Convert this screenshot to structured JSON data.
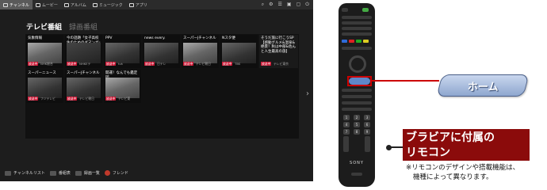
{
  "tv": {
    "topbar": {
      "tabs": [
        {
          "label": "チャンネル",
          "active": true
        },
        {
          "label": "ムービー",
          "active": false
        },
        {
          "label": "アルバム",
          "active": false
        },
        {
          "label": "ミュージック",
          "active": false
        },
        {
          "label": "アプリ",
          "active": false
        }
      ]
    },
    "section_title": "テレビ番組",
    "section_title_secondary": "録画番組",
    "tiles_row1": [
      {
        "title": "気象情報",
        "badge": "放送中",
        "channel": "NHK総合"
      },
      {
        "title": "今の話題「女子高校生のためのダマンガ」",
        "badge": "放送中",
        "channel": "NHKEテ"
      },
      {
        "title": "PPV",
        "badge": "放送中",
        "channel": "tvk"
      },
      {
        "title": "news every.",
        "badge": "放送中",
        "channel": "日テレ"
      },
      {
        "title": "スーパーJチャンネル",
        "badge": "放送中",
        "channel": "テレビ朝日"
      },
      {
        "title": "Nスタ便",
        "badge": "放送中",
        "channel": "TBS"
      },
      {
        "title": "そうだ旅に行こうSP【感動グルメ&温泉&絶景！秋は中部&佐んと人生最高の旅】",
        "badge": "放送中",
        "channel": "テレビ東京"
      }
    ],
    "tiles_row2": [
      {
        "title": "スーパーニュース",
        "badge": "放送中",
        "channel": "フジテレビ"
      },
      {
        "title": "スーパーJチャンネル",
        "badge": "放送中",
        "channel": "テレビ朝日"
      },
      {
        "title": "開運！なんでも鑑定団",
        "badge": "放送中",
        "channel": "テレビ東"
      }
    ],
    "bottombar": {
      "items": [
        "チャンネルリスト",
        "番組表",
        "録画一覧",
        "フレンド"
      ]
    }
  },
  "callout": {
    "home": "ホーム"
  },
  "label": {
    "line1": "ブラビアに付属の",
    "line2": "リモコン"
  },
  "note": {
    "line1": "※リモコンのデザインや搭載機能は、",
    "line2": "機種によって異なります。"
  },
  "remote": {
    "brand": "SONY"
  }
}
